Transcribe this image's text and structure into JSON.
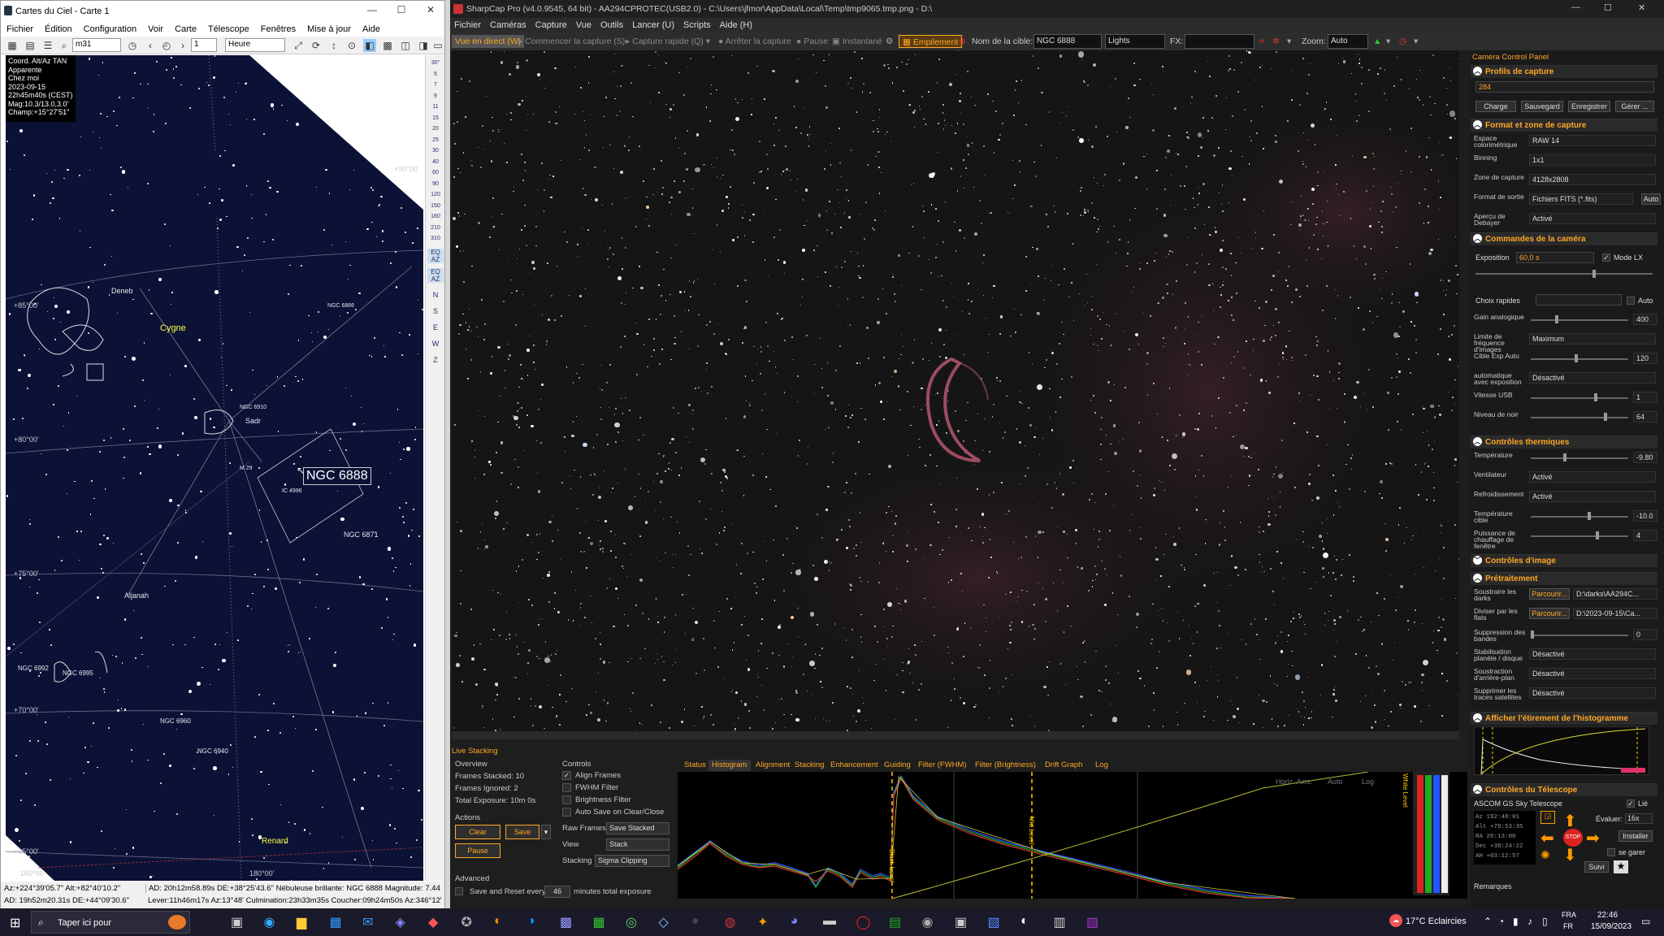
{
  "cdc": {
    "title": "Cartes du Ciel - Carte 1",
    "menu": [
      "Fichier",
      "Édition",
      "Configuration",
      "Voir",
      "Carte",
      "Télescope",
      "Fenêtres",
      "Mise à jour",
      "Aide"
    ],
    "search_value": "m31",
    "spin_value": "1",
    "time_mode": "Heure",
    "info": [
      "Coord. Alt/Az TAN",
      "Apparente",
      "Chez moi",
      "2023-09-15",
      "22h45m40s (CEST)",
      "Mag:10.3/13.0,3.0'",
      "Champ:+15°27'51\""
    ],
    "labels": {
      "deneb": "Deneb",
      "cygne": "Cygne",
      "sadr": "Sadr",
      "ngc6888": "NGC 6888",
      "ngc6871": "NGC 6871",
      "aljanah": "Aljanah",
      "ngc6992": "NGC 6992",
      "ngc6995": "NGC 6995",
      "ngc6960": "NGC 6960",
      "ngc6940": "NGC 6940",
      "renard": "Renard",
      "ngc6866": "NGC 6866",
      "ngc6910": "NGC 6910",
      "m29": "M 29",
      "ic4996": "IC 4996"
    },
    "grid": [
      "+90°00'",
      "+85°00'",
      "+80°00'",
      "+75°00'",
      "+70°00'",
      "+65°00'",
      "160°00'",
      "180°00'"
    ],
    "scale": [
      "30°",
      "5",
      "7",
      "9",
      "11",
      "15",
      "20",
      "25",
      "30",
      "40",
      "60",
      "90",
      "120",
      "150",
      "180",
      "210",
      "310"
    ],
    "side_labels": [
      "N",
      "S",
      "E",
      "W",
      "Z"
    ],
    "status": {
      "l1": "Az:+224°39'05.7\" Alt:+82°40'10.2\"",
      "l2": "AD: 19h52m20.31s DE:+44°09'30.6\"",
      "r1": "AD: 20h12m58.89s DE:+38°25'43.6\"  Nébuleuse brillante: NGC 6888   Magnitude: 7.44",
      "r2": "Lever:11h46m17s Az:13°48'  Culmination:23h33m35s  Coucher:09h24m50s Az:346°12'"
    }
  },
  "sc": {
    "title": "SharpCap Pro (v4.0.9545, 64 bit) - AA294CPROTEC(USB2.0) - C:\\Users\\jfmor\\AppData\\Local\\Temp\\tmp9065.tmp.png - D:\\",
    "menu": [
      "Fichier",
      "Caméras",
      "Capture",
      "Vue",
      "Outils",
      "Lancer (U)",
      "Scripts",
      "Aide (H)"
    ],
    "toolbar": {
      "live": "Vue en direct (W)",
      "start": "Commencer la capture (S)",
      "quick": "Capture rapide (Q)",
      "stop": "Arrêter la capture",
      "pause": "Pause",
      "snapshot": "Instantané",
      "stack": "Empilement",
      "target_label": "Nom de la cible:",
      "target": "NGC 6888",
      "frame_type": "Lights",
      "fx_label": "FX:",
      "zoom_label": "Zoom:",
      "zoom": "Auto"
    },
    "panel": {
      "title": "Camera Control Panel",
      "profiles": {
        "header": "Profils de capture",
        "value": "284",
        "b1": "Charge",
        "b2": "Sauvegard",
        "b3": "Enregistrer",
        "b4": "Gérer ..."
      },
      "format": {
        "header": "Format et zone de capture",
        "rows": [
          [
            "Espace colorimétrique",
            "RAW 14"
          ],
          [
            "Binning",
            "1x1"
          ],
          [
            "Zone de capture",
            "4128x2808"
          ],
          [
            "Format de sortie",
            "Fichiers FITS (*.fits)"
          ],
          [
            "Aperçu de Debayer",
            "Activé"
          ]
        ],
        "auto": "Auto"
      },
      "camera": {
        "header": "Commandes de la caméra",
        "exposure_label": "Exposition",
        "exposure": "60,0 s",
        "mode": "Mode LX",
        "choix": "Choix rapides",
        "auto": "Auto",
        "rows": [
          [
            "Gain analogique",
            "400"
          ],
          [
            "Limite de fréquence d'images",
            "Maximum"
          ],
          [
            "Cible Exp Auto",
            "120"
          ],
          [
            "automatique avec exposition",
            "Désactivé"
          ],
          [
            "Vitesse USB",
            "1"
          ],
          [
            "Niveau de noir",
            "64"
          ]
        ]
      },
      "thermal": {
        "header": "Contrôles thermiques",
        "rows": [
          [
            "Température",
            "-9.80"
          ],
          [
            "Ventilateur",
            "Activé"
          ],
          [
            "Refroidissement",
            "Activé"
          ],
          [
            "Température cible",
            "-10.0"
          ],
          [
            "Puissance de chauffage de fenêtre",
            "4"
          ]
        ]
      },
      "image": {
        "header": "Contrôles d'image"
      },
      "pre": {
        "header": "Prétraitement",
        "rows": [
          [
            "Soustraire les darks",
            "Parcourir...",
            "D:\\darks\\AA294C..."
          ],
          [
            "Diviser par les flats",
            "Parcourir...",
            "D:\\2023-09-15\\Ca..."
          ]
        ],
        "rows2": [
          [
            "Suppression des bandes",
            "0"
          ],
          [
            "Stabilisation planète / disque",
            "Désactivé"
          ],
          [
            "Soustraction d'arrière-plan",
            "Désactivé"
          ],
          [
            "Supprimer les traces satellites",
            "Désactivé"
          ]
        ]
      },
      "histo": {
        "header": "Afficher l'étirement de l'histogramme"
      },
      "scope": {
        "header": "Contrôles du Télescope",
        "name": "ASCOM GS Sky Telescope",
        "lie": "Lié",
        "eval_label": "Évaluer:",
        "eval": "16x",
        "install": "Installer",
        "park": "se garer",
        "follow": "Suivi",
        "coords": [
          "Az  192:48:01",
          "Alt  +79:53:35",
          "RA  20:13:00",
          "Dec  +38:24:22",
          "AH  +03:12:57"
        ],
        "remarks": "Remarques"
      }
    },
    "stacking": {
      "title": "Live Stacking",
      "overview": "Overview",
      "stacked": "Frames Stacked:  10",
      "ignored": "Frames Ignored:  2",
      "exposure": "Total Exposure:   10m 0s",
      "actions": "Actions",
      "clear": "Clear",
      "save": "Save",
      "pause": "Pause",
      "advanced": "Advanced",
      "save_reset": "Save and Reset every",
      "minutes": "46",
      "minutes_label": "minutes total exposure",
      "controls": "Controls",
      "c1": "Align Frames",
      "c2": "FWHM Filter",
      "c3": "Brightness Filter",
      "c4": "Auto Save on Clear/Close",
      "raw_label": "Raw Frames",
      "raw": "Save Stacked",
      "view_label": "View",
      "view": "Stack",
      "stacking_label": "Stacking",
      "stacking": "Sigma Clipping",
      "tabs": [
        "Status",
        "Histogram",
        "Alignment",
        "Stacking",
        "Enhancement",
        "Guiding",
        "Filter (FWHM)",
        "Filter (Brightness)",
        "Drift Graph",
        "Log"
      ],
      "horiz": "Horiz. Axis:",
      "auto": "Auto",
      "log": "Log",
      "black": "Black Level",
      "mid": "Mid Level",
      "white": "White Level"
    }
  },
  "taskbar": {
    "search": "Taper ici pour",
    "weather": "17°C  Eclaircies",
    "lang": "FRA",
    "lang2": "FR",
    "time": "22:46",
    "date": "15/09/2023"
  }
}
